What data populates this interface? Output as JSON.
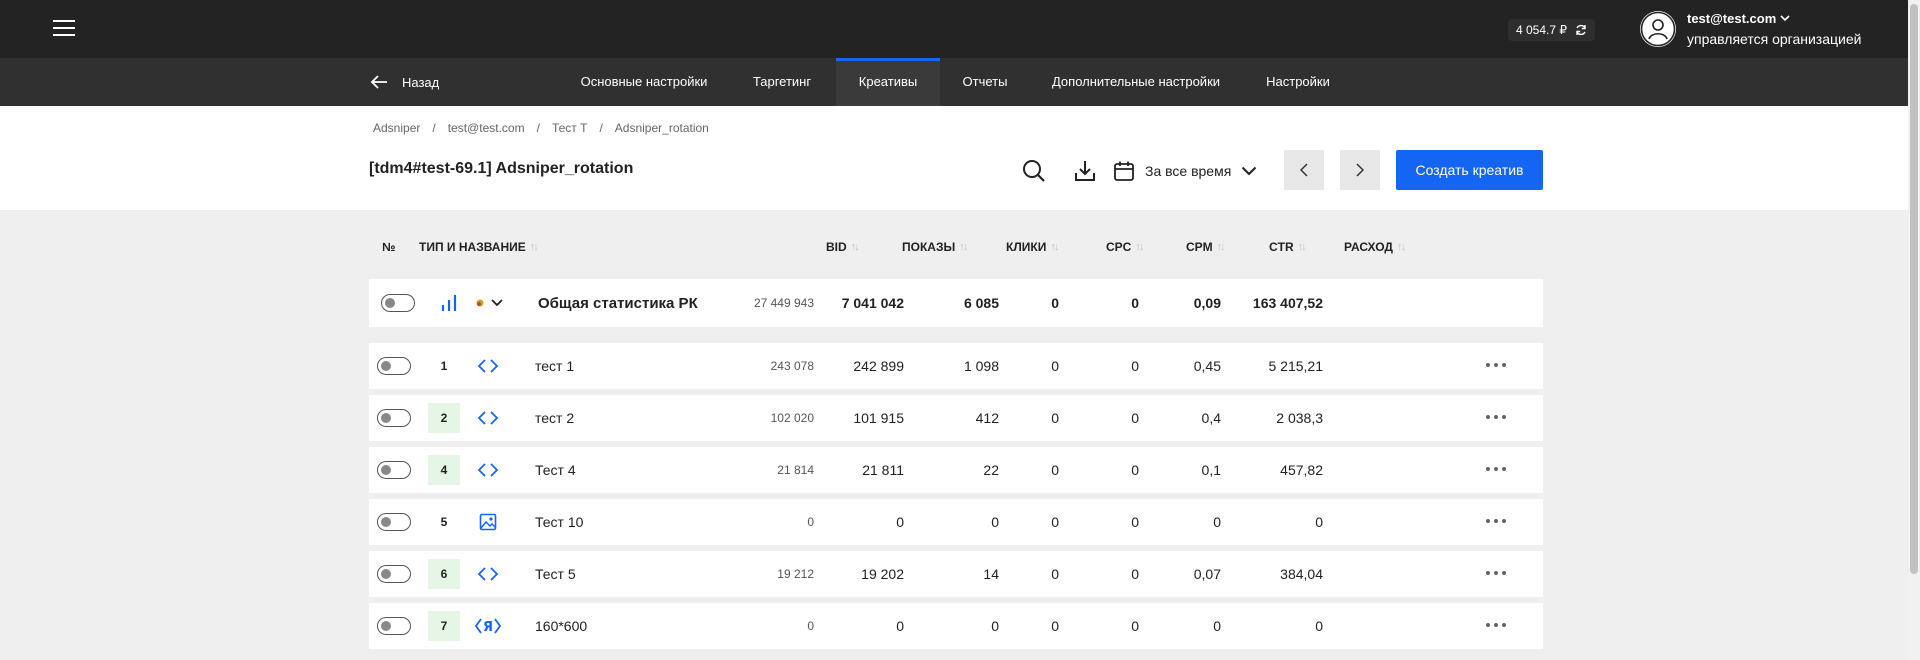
{
  "header": {
    "balance": "4 054.7 ₽",
    "user_email": "test@test.com",
    "user_org": "управляется организацией"
  },
  "nav": {
    "back_label": "Назад",
    "tabs": [
      {
        "label": "Основные настройки",
        "active": false
      },
      {
        "label": "Таргетинг",
        "active": false
      },
      {
        "label": "Креативы",
        "active": true
      },
      {
        "label": "Отчеты",
        "active": false
      },
      {
        "label": "Дополнительные настройки",
        "active": false
      },
      {
        "label": "Настройки",
        "active": false
      }
    ]
  },
  "breadcrumb": {
    "items": [
      "Adsniper",
      "test@test.com",
      "Тест Т",
      "Adsniper_rotation"
    ],
    "separator": "/"
  },
  "page": {
    "title": "[tdm4#test-69.1] Adsniper_rotation"
  },
  "toolbar": {
    "period": "За все время",
    "create_label": "Создать креатив"
  },
  "table": {
    "headers": {
      "num": "№",
      "type_name": "ТИП И НАЗВАНИЕ",
      "bid": "BID",
      "shows": "ПОКАЗЫ",
      "clicks": "КЛИКИ",
      "cpc": "CPC",
      "cpm": "CPM",
      "ctr": "CTR",
      "spend": "РАСХОД"
    },
    "total": {
      "name": "Общая статистика РК",
      "bid": "27 449 943",
      "shows": "7 041 042",
      "clicks": "6 085",
      "cpc": "0",
      "cpm": "0",
      "ctr": "0,09",
      "spend": "163 407,52"
    },
    "rows": [
      {
        "num": "1",
        "icon": "code-icon",
        "green": false,
        "name": "тест 1",
        "bid": "243 078",
        "shows": "242 899",
        "clicks": "1 098",
        "cpc": "0",
        "cpm": "0",
        "ctr": "0,45",
        "spend": "5 215,21"
      },
      {
        "num": "2",
        "icon": "code-icon",
        "green": true,
        "name": "тест 2",
        "bid": "102 020",
        "shows": "101 915",
        "clicks": "412",
        "cpc": "0",
        "cpm": "0",
        "ctr": "0,4",
        "spend": "2 038,3"
      },
      {
        "num": "4",
        "icon": "code-icon",
        "green": true,
        "name": "Тест 4",
        "bid": "21 814",
        "shows": "21 811",
        "clicks": "22",
        "cpc": "0",
        "cpm": "0",
        "ctr": "0,1",
        "spend": "457,82"
      },
      {
        "num": "5",
        "icon": "image-icon",
        "green": false,
        "name": "Тест 10",
        "bid": "0",
        "shows": "0",
        "clicks": "0",
        "cpc": "0",
        "cpm": "0",
        "ctr": "0",
        "spend": "0"
      },
      {
        "num": "6",
        "icon": "code-icon",
        "green": true,
        "name": "Тест 5",
        "bid": "19 212",
        "shows": "19 202",
        "clicks": "14",
        "cpc": "0",
        "cpm": "0",
        "ctr": "0,07",
        "spend": "384,04"
      },
      {
        "num": "7",
        "icon": "yandex-code-icon",
        "green": true,
        "name": "160*600",
        "bid": "0",
        "shows": "0",
        "clicks": "0",
        "cpc": "0",
        "cpm": "0",
        "ctr": "0",
        "spend": "0"
      }
    ]
  },
  "colors": {
    "accent": "#1565f5",
    "topbar": "#232323",
    "navbar": "#303030",
    "badge_green": "#e6f6e6"
  }
}
